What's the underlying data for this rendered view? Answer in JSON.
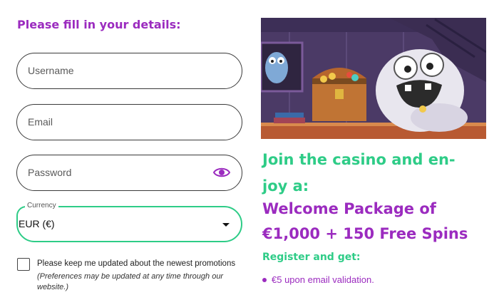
{
  "form": {
    "title": "Please fill in your details:",
    "username": {
      "placeholder": "Username"
    },
    "email": {
      "placeholder": "Email"
    },
    "password": {
      "placeholder": "Password"
    },
    "currency": {
      "legend": "Currency",
      "selected": "EUR (€)"
    },
    "newsletter": {
      "checked": false,
      "label": "Please keep me updated about the newest promotions",
      "note": "(Preferences may be updated at any time through our website.)"
    }
  },
  "promo": {
    "headline_green": "Join the casino and en-joy a:",
    "headline_purple": "Welcome Package of €1,000 + 150 Free Spins",
    "register_title": "Register and get:",
    "bullets": [
      "€5 upon email validation."
    ]
  },
  "colors": {
    "purple": "#9b2bbf",
    "green": "#2ecc87"
  },
  "icons": {
    "password_toggle": "eye-icon",
    "currency_dropdown": "caret-down-icon"
  }
}
